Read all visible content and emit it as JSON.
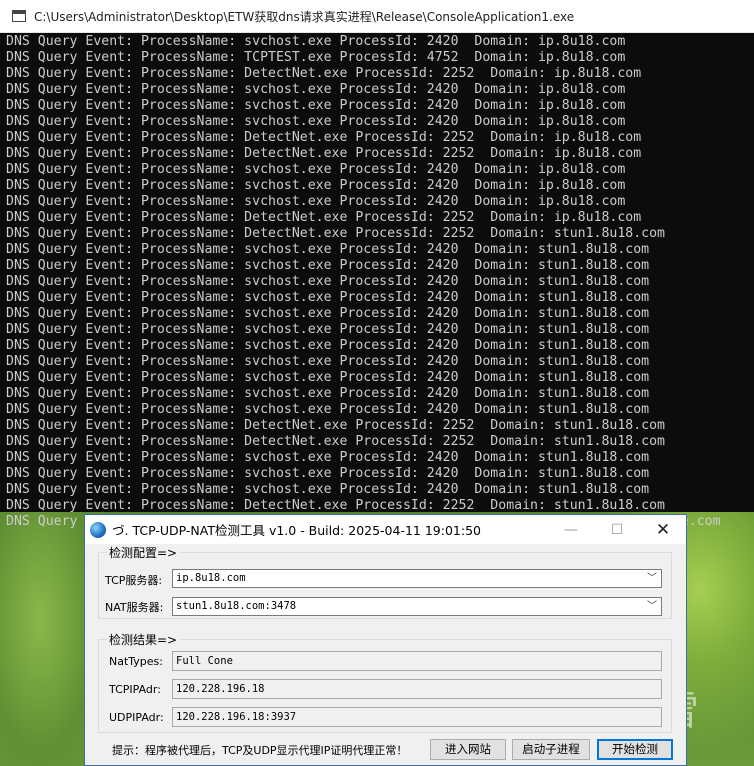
{
  "console": {
    "title": "C:\\Users\\Administrator\\Desktop\\ETW获取dns请求真实进程\\Release\\ConsoleApplication1.exe",
    "lines": [
      "DNS Query Event: ProcessName: svchost.exe ProcessId: 2420  Domain: ip.8u18.com",
      "DNS Query Event: ProcessName: TCPTEST.exe ProcessId: 4752  Domain: ip.8u18.com",
      "DNS Query Event: ProcessName: DetectNet.exe ProcessId: 2252  Domain: ip.8u18.com",
      "DNS Query Event: ProcessName: svchost.exe ProcessId: 2420  Domain: ip.8u18.com",
      "DNS Query Event: ProcessName: svchost.exe ProcessId: 2420  Domain: ip.8u18.com",
      "DNS Query Event: ProcessName: svchost.exe ProcessId: 2420  Domain: ip.8u18.com",
      "DNS Query Event: ProcessName: DetectNet.exe ProcessId: 2252  Domain: ip.8u18.com",
      "DNS Query Event: ProcessName: DetectNet.exe ProcessId: 2252  Domain: ip.8u18.com",
      "DNS Query Event: ProcessName: svchost.exe ProcessId: 2420  Domain: ip.8u18.com",
      "DNS Query Event: ProcessName: svchost.exe ProcessId: 2420  Domain: ip.8u18.com",
      "DNS Query Event: ProcessName: svchost.exe ProcessId: 2420  Domain: ip.8u18.com",
      "DNS Query Event: ProcessName: DetectNet.exe ProcessId: 2252  Domain: ip.8u18.com",
      "DNS Query Event: ProcessName: DetectNet.exe ProcessId: 2252  Domain: stun1.8u18.com",
      "DNS Query Event: ProcessName: svchost.exe ProcessId: 2420  Domain: stun1.8u18.com",
      "DNS Query Event: ProcessName: svchost.exe ProcessId: 2420  Domain: stun1.8u18.com",
      "DNS Query Event: ProcessName: svchost.exe ProcessId: 2420  Domain: stun1.8u18.com",
      "DNS Query Event: ProcessName: svchost.exe ProcessId: 2420  Domain: stun1.8u18.com",
      "DNS Query Event: ProcessName: svchost.exe ProcessId: 2420  Domain: stun1.8u18.com",
      "DNS Query Event: ProcessName: svchost.exe ProcessId: 2420  Domain: stun1.8u18.com",
      "DNS Query Event: ProcessName: svchost.exe ProcessId: 2420  Domain: stun1.8u18.com",
      "DNS Query Event: ProcessName: svchost.exe ProcessId: 2420  Domain: stun1.8u18.com",
      "DNS Query Event: ProcessName: svchost.exe ProcessId: 2420  Domain: stun1.8u18.com",
      "DNS Query Event: ProcessName: svchost.exe ProcessId: 2420  Domain: stun1.8u18.com",
      "DNS Query Event: ProcessName: svchost.exe ProcessId: 2420  Domain: stun1.8u18.com",
      "DNS Query Event: ProcessName: DetectNet.exe ProcessId: 2252  Domain: stun1.8u18.com",
      "DNS Query Event: ProcessName: DetectNet.exe ProcessId: 2252  Domain: stun1.8u18.com",
      "DNS Query Event: ProcessName: svchost.exe ProcessId: 2420  Domain: stun1.8u18.com",
      "DNS Query Event: ProcessName: svchost.exe ProcessId: 2420  Domain: stun1.8u18.com",
      "DNS Query Event: ProcessName: svchost.exe ProcessId: 2420  Domain: stun1.8u18.com",
      "DNS Query Event: ProcessName: DetectNet.exe ProcessId: 2252  Domain: stun1.8u18.com",
      "DNS Query Event: ProcessName: svchost.exe ProcessId: 3884  Domain: ctldl.windowsupdate.com"
    ]
  },
  "dialog": {
    "title": "づ. TCP-UDP-NAT检测工具 v1.0  -  Build: 2025-04-11 19:01:50",
    "config": {
      "group_title": "检测配置=>",
      "tcp_label": "TCP服务器:",
      "tcp_value": "ip.8u18.com",
      "nat_label": "NAT服务器:",
      "nat_value": "stun1.8u18.com:3478"
    },
    "result": {
      "group_title": "检测结果=>",
      "nattype_label": "NatTypes:",
      "nattype_value": "Full Cone",
      "tcpip_label": "TCPIPAdr:",
      "tcpip_value": "120.228.196.18",
      "udpip_label": "UDPIPAdr:",
      "udpip_value": "120.228.196.18:3937"
    },
    "tip": "提示：程序被代理后，TCP及UDP显示代理IP证明代理正常！",
    "buttons": {
      "open_site": "进入网站",
      "start_subprocess": "启动子进程",
      "start_detect": "开始检测"
    }
  },
  "watermark": {
    "text": "看雪"
  }
}
